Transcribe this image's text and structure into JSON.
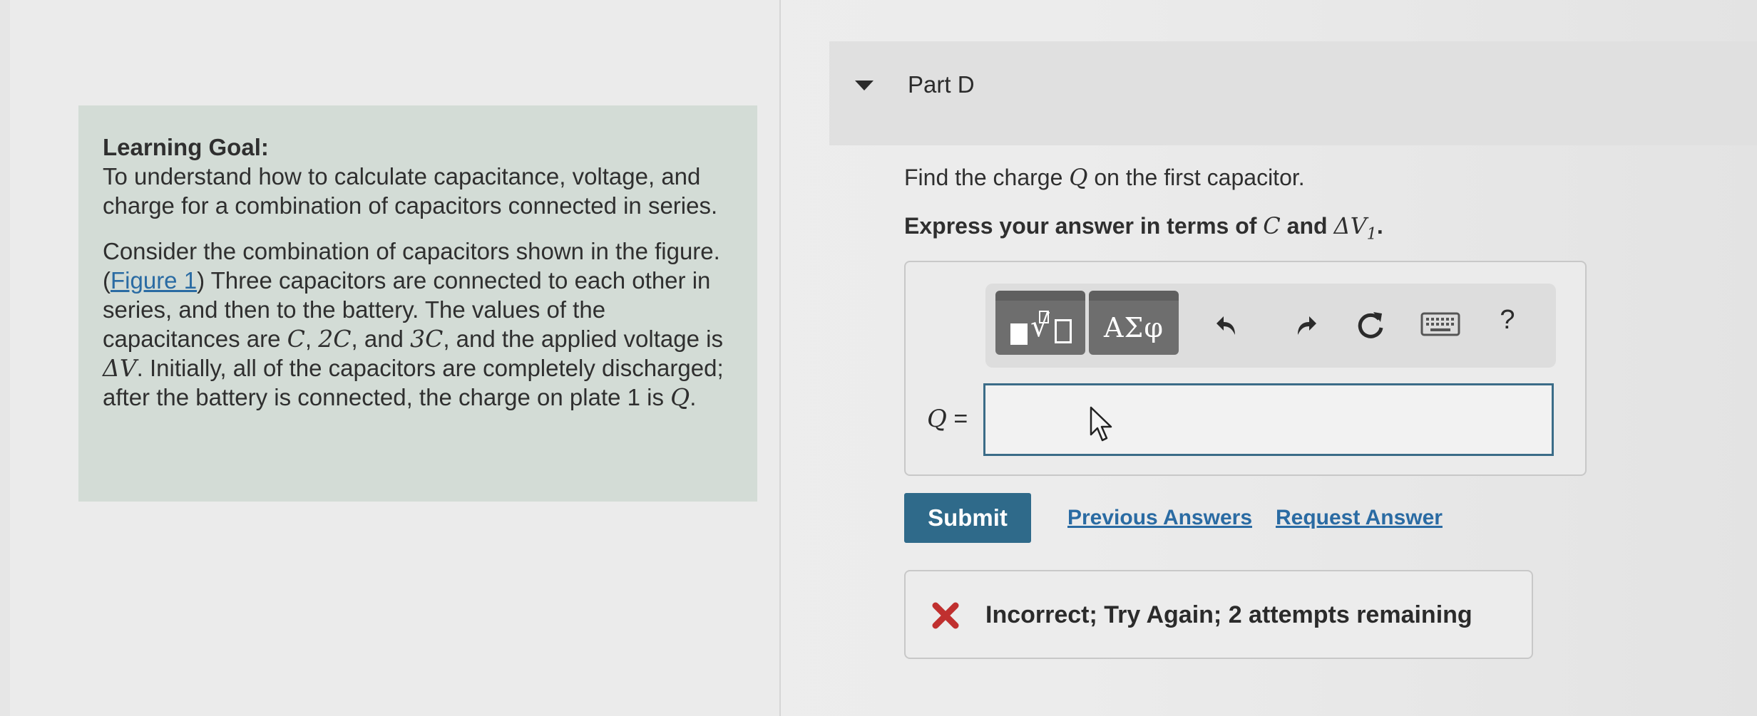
{
  "learning_goal": {
    "title": "Learning Goal:",
    "text": "To understand how to calculate capacitance, voltage, and charge for a combination of capacitors connected in series.",
    "consider_prefix": "Consider the combination of capacitors shown in the figure.(",
    "figure_link": "Figure 1",
    "consider_mid1": ") Three capacitors are connected to each other in series, and then to the battery. The values of the capacitances are ",
    "cap1": "C",
    "sep1": ", ",
    "cap2": "2C",
    "sep2": ", and ",
    "cap3": "3C",
    "consider_mid2": ", and the applied voltage is ",
    "voltage": "ΔV",
    "consider_mid3": ". Initially, all of the capacitors are completely discharged; after the battery is connected, the charge on plate 1 is ",
    "charge": "Q",
    "consider_end": "."
  },
  "part": {
    "title": "Part D"
  },
  "question": {
    "prefix": "Find the charge ",
    "var": "Q",
    "suffix": " on the first capacitor."
  },
  "instruction": {
    "prefix": "Express your answer in terms of ",
    "var1": "C",
    "mid": " and ",
    "var2": "ΔV",
    "var2_sub": "1",
    "suffix": "."
  },
  "toolbar": {
    "greek_label": "ΑΣφ",
    "help_label": "?"
  },
  "answer": {
    "label_var": "Q",
    "label_eq": " =",
    "value": ""
  },
  "actions": {
    "submit_label": "Submit",
    "previous_answers": "Previous Answers",
    "request_answer": "Request Answer"
  },
  "feedback": {
    "text": "Incorrect; Try Again; 2 attempts remaining",
    "status_color": "#c0302f"
  }
}
